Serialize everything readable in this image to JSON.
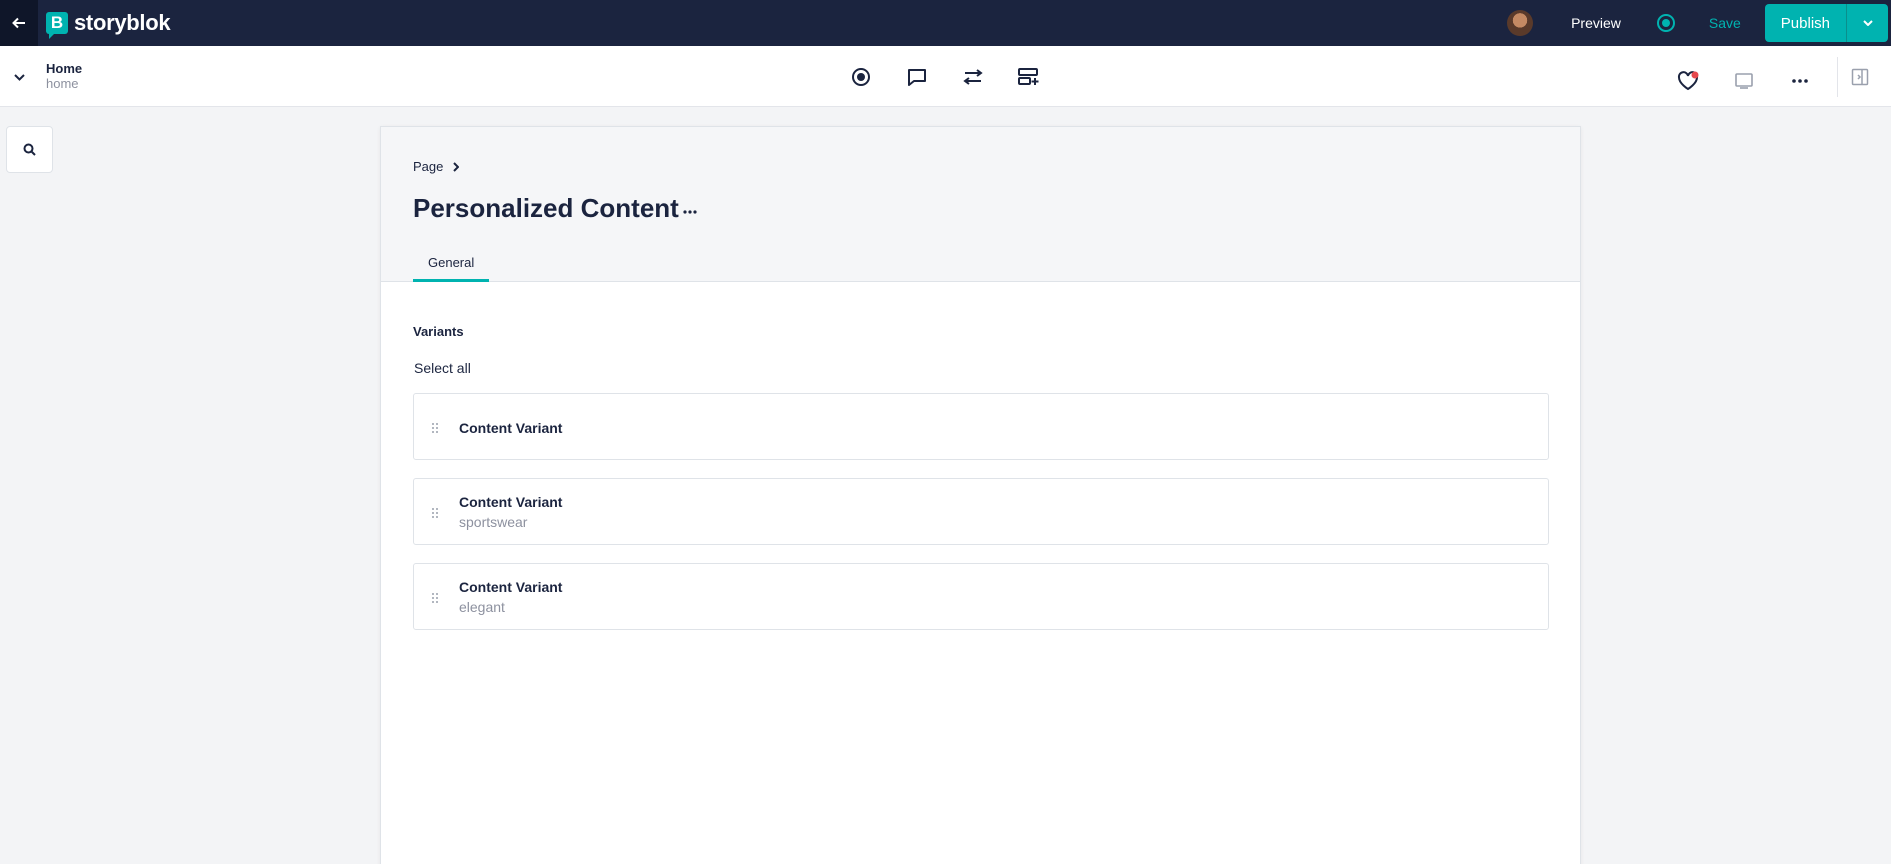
{
  "app": {
    "name": "storyblok"
  },
  "topbar": {
    "preview_label": "Preview",
    "save_label": "Save",
    "publish_label": "Publish"
  },
  "story": {
    "name": "Home",
    "slug": "home"
  },
  "editor": {
    "breadcrumb": "Page",
    "title": "Personalized Content",
    "tabs": [
      {
        "label": "General",
        "active": true
      }
    ],
    "field_label": "Variants",
    "select_all_label": "Select all",
    "variants": [
      {
        "title": "Content Variant",
        "subtitle": ""
      },
      {
        "title": "Content Variant",
        "subtitle": "sportswear"
      },
      {
        "title": "Content Variant",
        "subtitle": "elegant"
      }
    ]
  },
  "colors": {
    "topbar": "#1b243f",
    "accent": "#00b3b0",
    "background": "#f3f4f6"
  },
  "icons": [
    "back-arrow-icon",
    "storyblok-logo-icon",
    "status-dot-icon",
    "chevron-down-icon",
    "visual-editor-icon",
    "comments-icon",
    "settings-sliders-icon",
    "add-block-icon",
    "heart-icon",
    "device-preview-icon",
    "more-icon",
    "sidebar-toggle-icon",
    "search-icon",
    "chevron-right-icon",
    "drag-handle-icon"
  ]
}
